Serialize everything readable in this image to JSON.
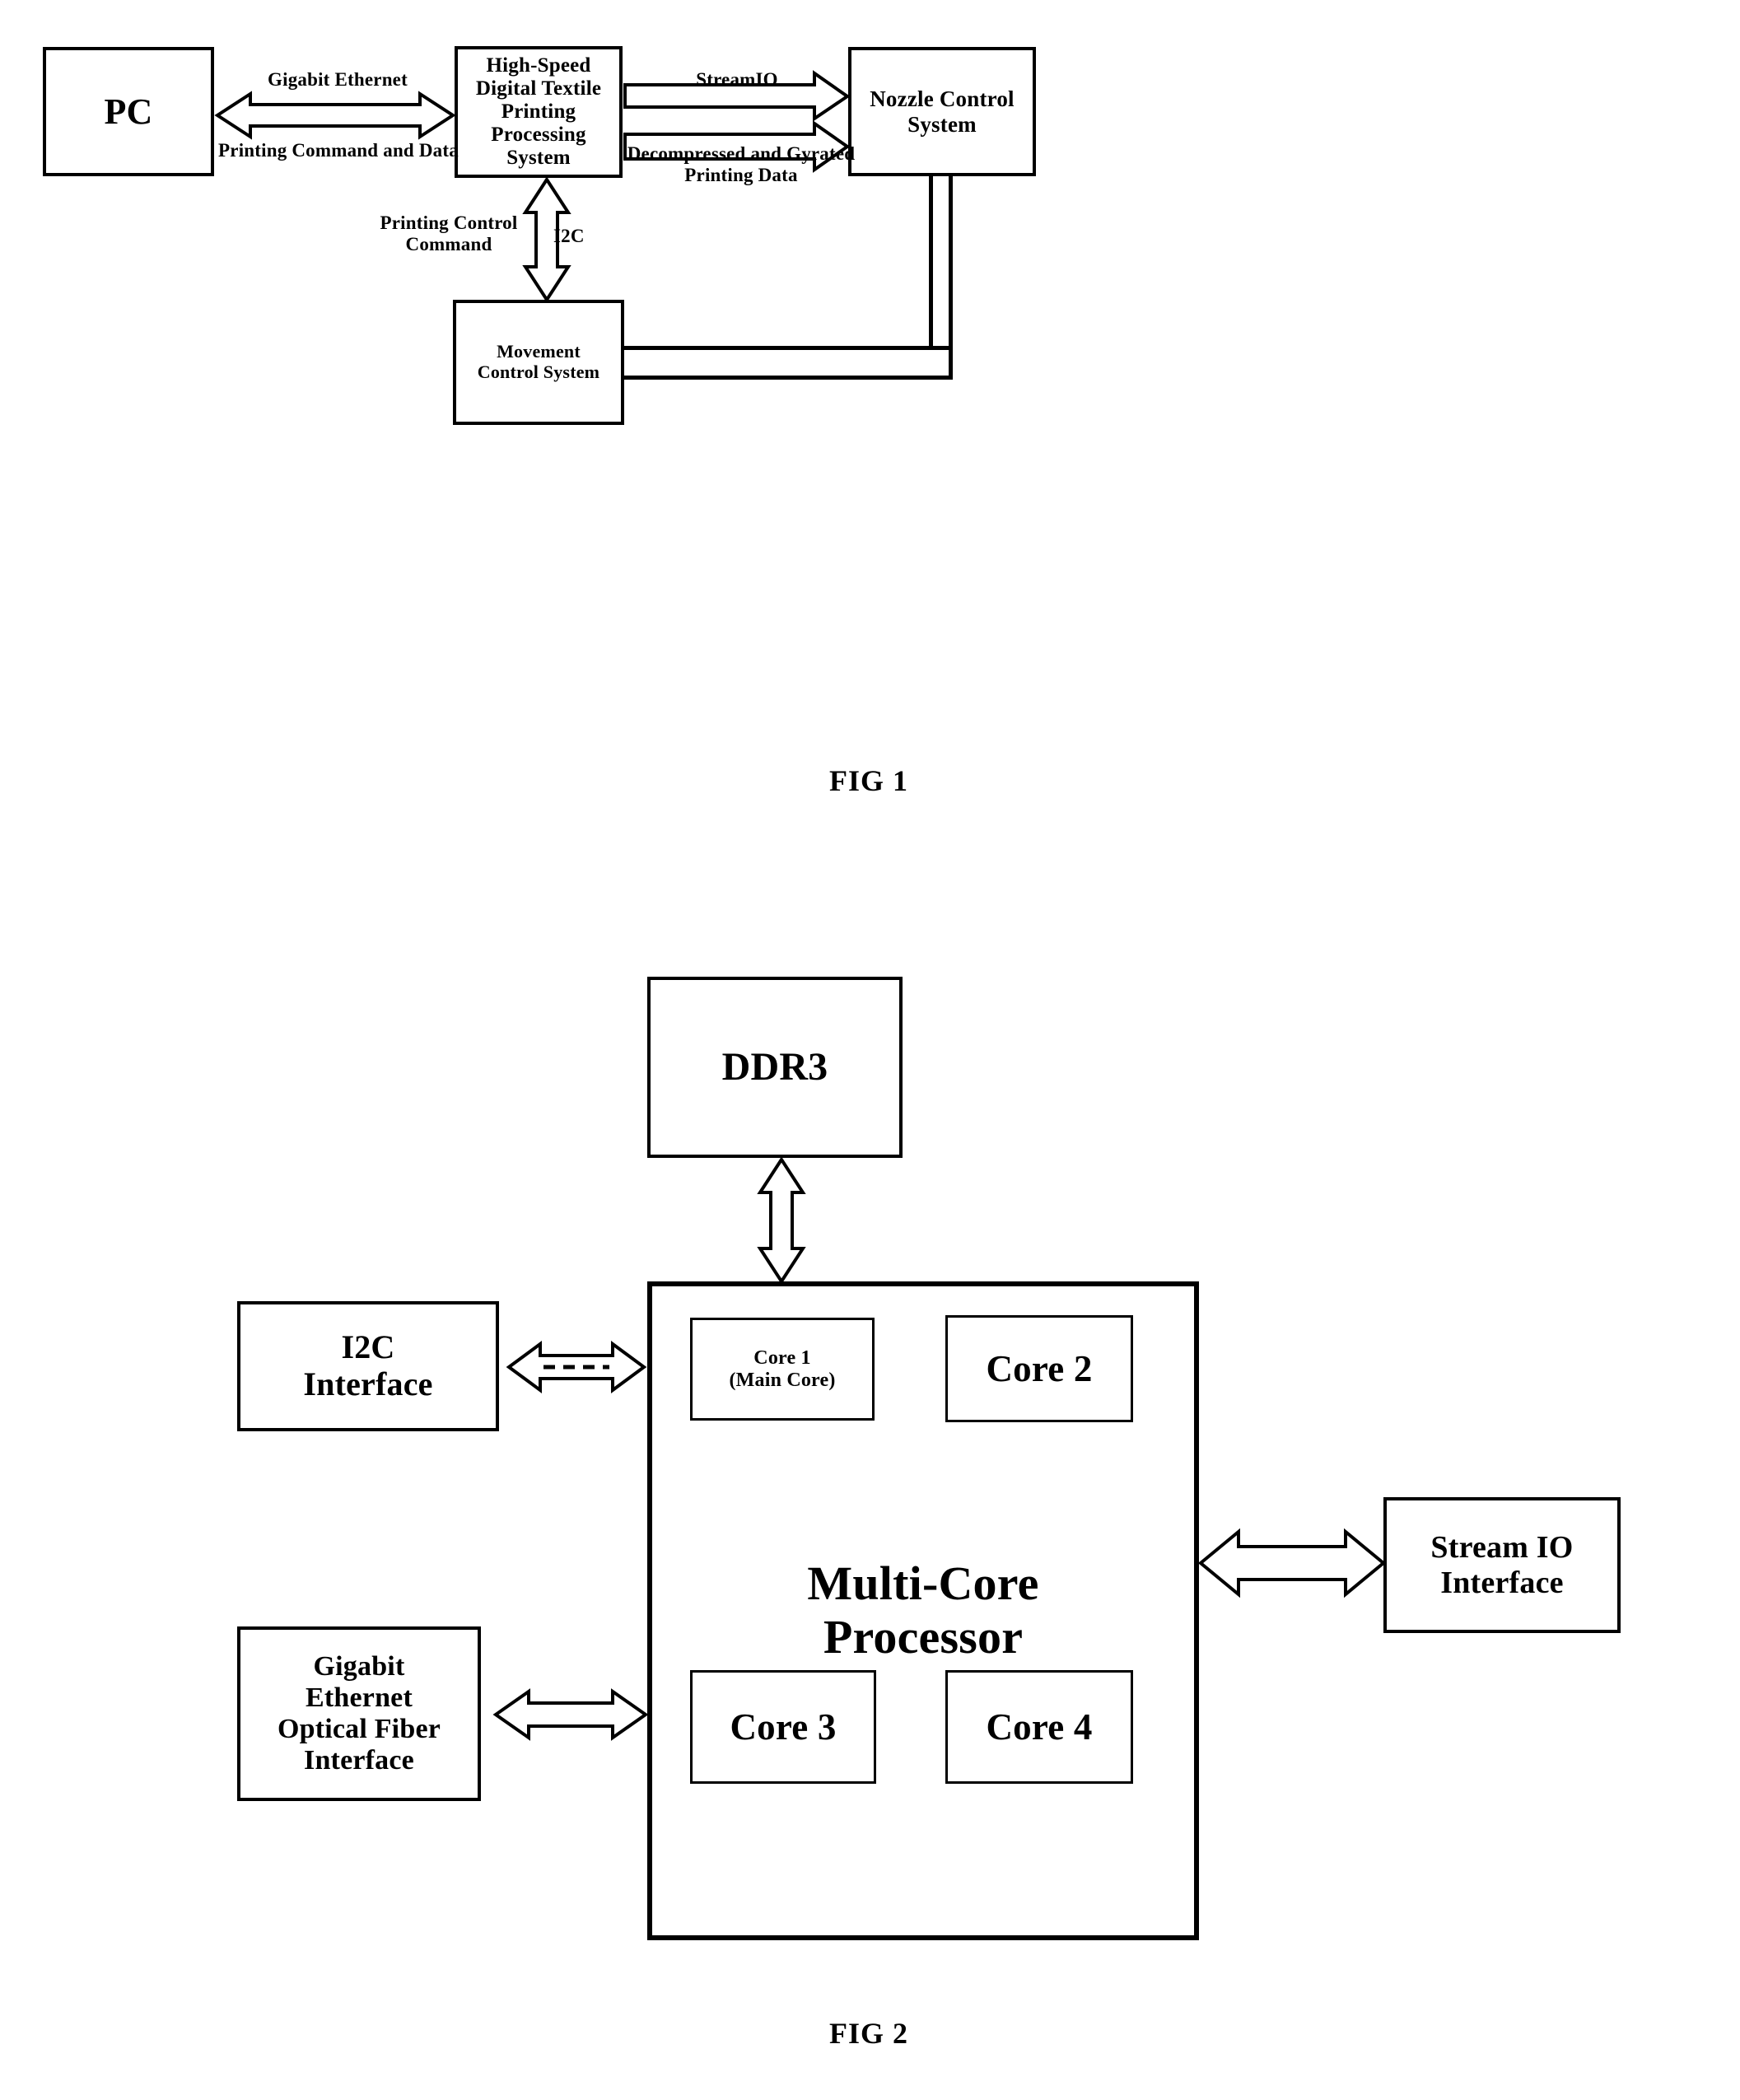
{
  "document": {
    "type": "patent-drawing-sheet",
    "background_color": "#ffffff",
    "ink_color": "#000000"
  },
  "figure1": {
    "caption": "FIG 1",
    "boxes": {
      "pc": "PC",
      "processing_system": "High-Speed\nDigital Textile\nPrinting\nProcessing\nSystem",
      "nozzle_control": "Nozzle Control\nSystem",
      "movement_control": "Movement\nControl System"
    },
    "edge_labels": {
      "gigabit_ethernet": "Gigabit Ethernet",
      "printing_command_and_data": "Printing Command and Data",
      "stream_io": "StreamIO",
      "decompressed_gyrated": "Decompressed and Gyrated\nPrinting Data",
      "printing_control_command": "Printing Control\nCommand",
      "i2c": "I2C"
    }
  },
  "figure2": {
    "caption": "FIG 2",
    "boxes": {
      "ddr3": "DDR3",
      "i2c_interface": "I2C\nInterface",
      "gigabit_interface": "Gigabit\nEthernet\nOptical Fiber\nInterface",
      "stream_io_interface": "Stream IO\nInterface",
      "processor": "Multi-Core\nProcessor",
      "core1": "Core 1\n(Main Core)",
      "core2": "Core 2",
      "core3": "Core 3",
      "core4": "Core 4"
    }
  }
}
